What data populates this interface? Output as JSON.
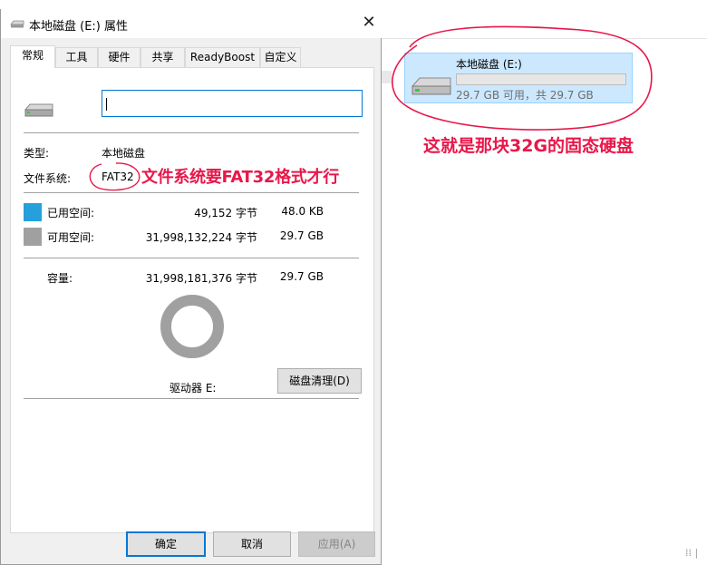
{
  "dialog": {
    "title": "本地磁盘 (E:) 属性",
    "close_glyph": "✕",
    "tabs": [
      "常规",
      "工具",
      "硬件",
      "共享",
      "ReadyBoost",
      "自定义"
    ],
    "active_tab": "常规",
    "name_value": "",
    "type_label": "类型:",
    "type_value": "本地磁盘",
    "fs_label": "文件系统:",
    "fs_value": "FAT32",
    "used": {
      "label": "已用空间:",
      "bytes": "49,152 字节",
      "size": "48.0 KB",
      "color": "#26a0da"
    },
    "free": {
      "label": "可用空间:",
      "bytes": "31,998,132,224 字节",
      "size": "29.7 GB",
      "color": "#a0a0a0"
    },
    "capacity": {
      "label": "容量:",
      "bytes": "31,998,181,376 字节",
      "size": "29.7 GB"
    },
    "drive_label": "驱动器 E:",
    "cleanup_button": "磁盘清理(D)",
    "ok_button": "确定",
    "cancel_button": "取消",
    "apply_button": "应用(A)"
  },
  "drive_tile": {
    "name": "本地磁盘 (E:)",
    "free_text": "29.7 GB 可用，共 29.7 GB",
    "used_fraction": 0.0
  },
  "annotations": {
    "drive_note": "这就是那块32G的固态硬盘",
    "fs_note": "文件系统要FAT32格式才行",
    "color": "#e8174a"
  },
  "corner_text": "⁞⁞ |"
}
